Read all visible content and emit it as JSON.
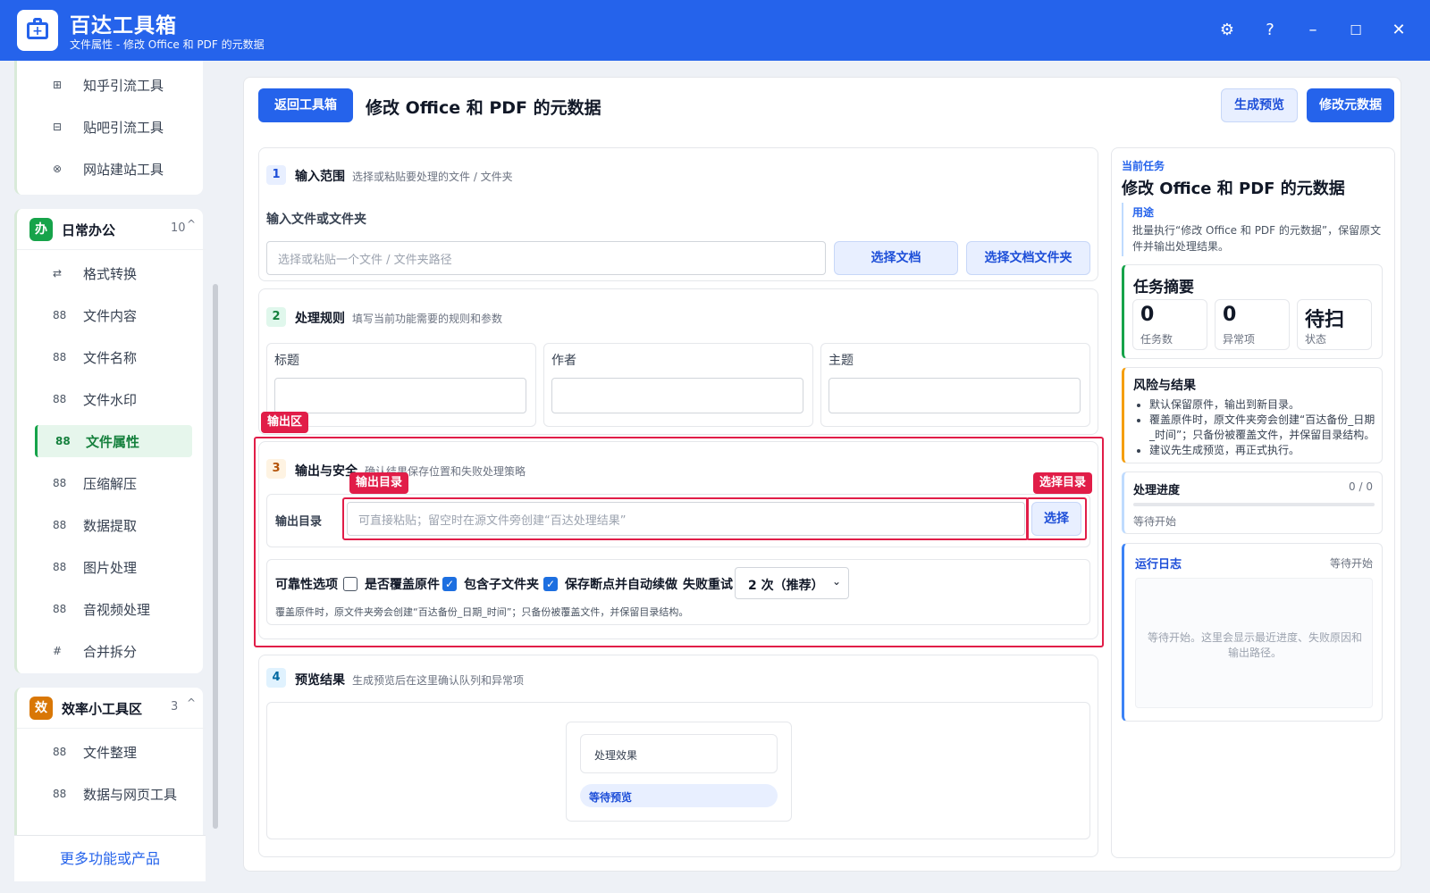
{
  "window": {
    "title": "百达工具箱",
    "subtitle": "文件属性 - 修改 Office 和 PDF 的元数据",
    "controls": {
      "settings": "⚙",
      "help": "?",
      "minimize": "–",
      "maximize": "☐",
      "close": "✕"
    }
  },
  "sidebar": {
    "top_items": [
      {
        "label": "知乎引流工具",
        "icon": "⊞"
      },
      {
        "label": "贴吧引流工具",
        "icon": "⊟"
      },
      {
        "label": "网站建站工具",
        "icon": "⊗"
      }
    ],
    "groups": [
      {
        "badge": "办",
        "name": "日常办公",
        "count": "10",
        "chevron": "^",
        "items": [
          {
            "label": "格式转换",
            "icon": "⇄"
          },
          {
            "label": "文件内容",
            "icon": "88"
          },
          {
            "label": "文件名称",
            "icon": "88"
          },
          {
            "label": "文件水印",
            "icon": "88"
          },
          {
            "label": "文件属性",
            "icon": "88"
          },
          {
            "label": "压缩解压",
            "icon": "88"
          },
          {
            "label": "数据提取",
            "icon": "88"
          },
          {
            "label": "图片处理",
            "icon": "88"
          },
          {
            "label": "音视频处理",
            "icon": "88"
          },
          {
            "label": "合并拆分",
            "icon": "#"
          }
        ]
      },
      {
        "badge": "效",
        "name": "效率小工具区",
        "count": "3",
        "chevron": "^",
        "items": [
          {
            "label": "文件整理",
            "icon": "88"
          },
          {
            "label": "数据与网页工具",
            "icon": "88"
          }
        ]
      }
    ],
    "more_label": "更多功能或产品"
  },
  "main": {
    "back_button": "返回工具箱",
    "title": "修改 Office 和 PDF 的元数据",
    "preview_button": "生成预览",
    "run_button": "修改元数据",
    "section1": {
      "num": "1",
      "title": "输入范围",
      "desc": "选择或粘贴要处理的文件 / 文件夹",
      "field_label": "输入文件或文件夹",
      "placeholder": "选择或粘贴一个文件 / 文件夹路径",
      "select_doc": "选择文档",
      "select_folder": "选择文档文件夹"
    },
    "section2": {
      "num": "2",
      "title": "处理规则",
      "desc": "填写当前功能需要的规则和参数",
      "params": [
        "标题",
        "作者",
        "主题"
      ]
    },
    "section3": {
      "num": "3",
      "title": "输出与安全",
      "desc": "确认结果保存位置和失败处理策略",
      "out_label": "输出目录",
      "out_placeholder": "可直接粘贴；留空时在源文件旁创建“百达处理结果”",
      "choose_button": "选择",
      "reliability_label": "可靠性选项",
      "opt_overwrite": "是否覆盖原件",
      "opt_subfolders": "包含子文件夹",
      "opt_resume": "保存断点并自动续做",
      "retry_label": "失败重试",
      "retry_value": "2 次（推荐）",
      "note": "覆盖原件时，原文件夹旁会创建“百达备份_日期_时间”；只备份被覆盖文件，并保留目录结构。"
    },
    "annotations": {
      "output_area": "输出区",
      "output_dir": "输出目录",
      "choose_dir": "选择目录"
    },
    "section4": {
      "num": "4",
      "title": "预览结果",
      "desc": "生成预览后在这里确认队列和异常项",
      "effect_label": "处理效果",
      "pending_badge": "等待预览"
    }
  },
  "right": {
    "current_task_label": "当前任务",
    "task_title": "修改 Office 和 PDF 的元数据",
    "usage_label": "用途",
    "usage_text": "批量执行“修改 Office 和 PDF 的元数据”，保留原文件并输出处理结果。",
    "summary_title": "任务摘要",
    "stats": [
      {
        "value": "0",
        "label": "任务数"
      },
      {
        "value": "0",
        "label": "异常项"
      },
      {
        "value": "待扫",
        "label": "状态"
      }
    ],
    "risk_title": "风险与结果",
    "risks": [
      "默认保留原件，输出到新目录。",
      "覆盖原件时，原文件夹旁会创建“百达备份_日期_时间”；只备份被覆盖文件，并保留目录结构。",
      "建议先生成预览，再正式执行。"
    ],
    "progress_title": "处理进度",
    "progress_count": "0 / 0",
    "progress_fraction": 0,
    "progress_status": "等待开始",
    "log_title": "运行日志",
    "log_status": "等待开始",
    "log_placeholder": "等待开始。这里会显示最近进度、失败原因和输出路径。"
  },
  "colors": {
    "primary": "#2563eb",
    "accent_green": "#16a34a",
    "annotation_red": "#e11d48",
    "risk_orange": "#f59e0b"
  }
}
